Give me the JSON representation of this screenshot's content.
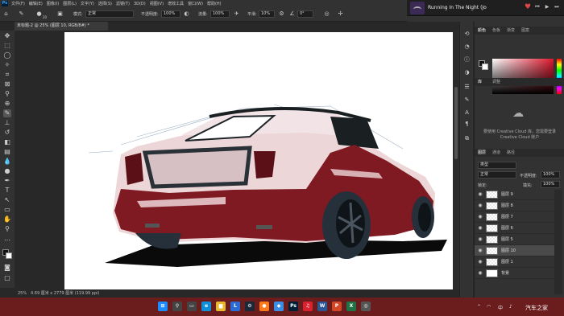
{
  "menubar": {
    "logo": "Ps",
    "items": [
      "文件(F)",
      "编辑(E)",
      "图像(I)",
      "图层(L)",
      "文字(Y)",
      "选择(S)",
      "滤镜(T)",
      "3D(D)",
      "视图(V)",
      "增效工具",
      "窗口(W)",
      "帮助(H)"
    ]
  },
  "media": {
    "track": "Running In The Night (Jo",
    "controls": [
      "prev-icon",
      "play-icon",
      "next-icon"
    ]
  },
  "options": {
    "brush_size": "20",
    "mode_label": "模式:",
    "mode_value": "正常",
    "opacity_label": "不透明度:",
    "opacity_value": "100%",
    "flow_label": "流量:",
    "flow_value": "100%",
    "smooth_label": "平滑:",
    "smooth_value": "10%",
    "angle_value": "0°"
  },
  "document": {
    "tab_title": "未标题-2 @ 25% (图层 10, RGB/8#) *",
    "status_zoom": "25%",
    "status_info": "4.69 厘米 x 2779 厘米 (119.99 ppi)"
  },
  "panels": {
    "color_tabs": [
      "颜色",
      "色板",
      "渐变",
      "图案"
    ],
    "library_tabs": [
      "库",
      "调整"
    ],
    "cc_message": "要使用 Creative Cloud 库，您需要登录 Creative Cloud 账户",
    "layer_tabs": [
      "图层",
      "通道",
      "路径"
    ],
    "filter_label": "类型",
    "blend_mode": "正常",
    "opacity_label": "不透明度:",
    "opacity_value": "100%",
    "lock_label": "锁定:",
    "fill_label": "填充:",
    "fill_value": "100%"
  },
  "layers": [
    {
      "name": "图层 9",
      "selected": false
    },
    {
      "name": "图层 8",
      "selected": false
    },
    {
      "name": "图层 7",
      "selected": false
    },
    {
      "name": "图层 6",
      "selected": false
    },
    {
      "name": "图层 5",
      "selected": false
    },
    {
      "name": "图层 10",
      "selected": true
    },
    {
      "name": "图层 1",
      "selected": false
    },
    {
      "name": "背景",
      "selected": false
    }
  ],
  "taskbar": {
    "apps": [
      {
        "icon": "windows-start-icon",
        "color": "#1b8cff"
      },
      {
        "icon": "search-icon",
        "color": "#444444"
      },
      {
        "icon": "task-view-icon",
        "color": "#444444"
      },
      {
        "icon": "edge-browser-icon",
        "color": "#0f8fd8"
      },
      {
        "icon": "file-explorer-icon",
        "color": "#e8b830"
      },
      {
        "icon": "browser-l-icon",
        "color": "#2b6bd6"
      },
      {
        "icon": "steam-icon",
        "color": "#1b2838"
      },
      {
        "icon": "app-orange-icon",
        "color": "#ff7a1a"
      },
      {
        "icon": "app-blue-icon",
        "color": "#3a8ee6"
      },
      {
        "icon": "photoshop-icon",
        "color": "#001e36"
      },
      {
        "icon": "netease-music-icon",
        "color": "#d9232e"
      },
      {
        "icon": "word-icon",
        "color": "#2b5797"
      },
      {
        "icon": "powerpoint-icon",
        "color": "#d24726"
      },
      {
        "icon": "excel-icon",
        "color": "#1f7244"
      },
      {
        "icon": "game-app-icon",
        "color": "#555555"
      }
    ],
    "tray_input": "中",
    "watermark": "汽车之家"
  }
}
